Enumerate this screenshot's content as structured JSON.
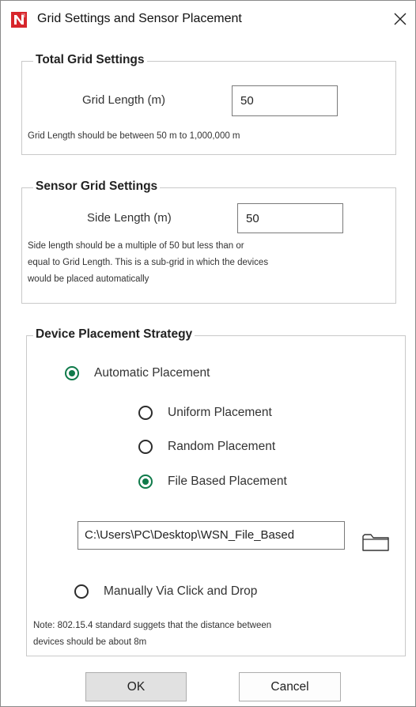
{
  "window": {
    "title": "Grid Settings and Sensor Placement",
    "close_glyph": "✕"
  },
  "total_grid": {
    "legend": "Total Grid Settings",
    "field_label": "Grid Length (m)",
    "value": "50",
    "hint": "Grid Length should be between 50 m to 1,000,000 m"
  },
  "sensor_grid": {
    "legend": "Sensor Grid Settings",
    "field_label": "Side Length (m)",
    "value": "50",
    "hint_lines": [
      "Side length should be a multiple of 50 but less than or",
      "equal to Grid Length. This is a sub-grid in which the devices",
      "would be placed automatically"
    ]
  },
  "placement": {
    "legend": "Device Placement Strategy",
    "automatic_label": "Automatic Placement",
    "automatic_checked": true,
    "sub_options": [
      {
        "label": "Uniform Placement",
        "checked": false
      },
      {
        "label": "Random Placement",
        "checked": false
      },
      {
        "label": "File Based Placement",
        "checked": true
      }
    ],
    "file_path": "C:\\Users\\PC\\Desktop\\WSN_File_Based",
    "folder_icon": "folder-icon",
    "manual_label": "Manually Via Click and Drop",
    "manual_checked": false,
    "note_lines": [
      "Note: 802.15.4 standard suggets that the distance between",
      "devices should be about 8m"
    ]
  },
  "buttons": {
    "ok": "OK",
    "cancel": "Cancel"
  },
  "colors": {
    "app_icon_red": "#d7262c",
    "radio_selected": "#0f7a4a"
  }
}
